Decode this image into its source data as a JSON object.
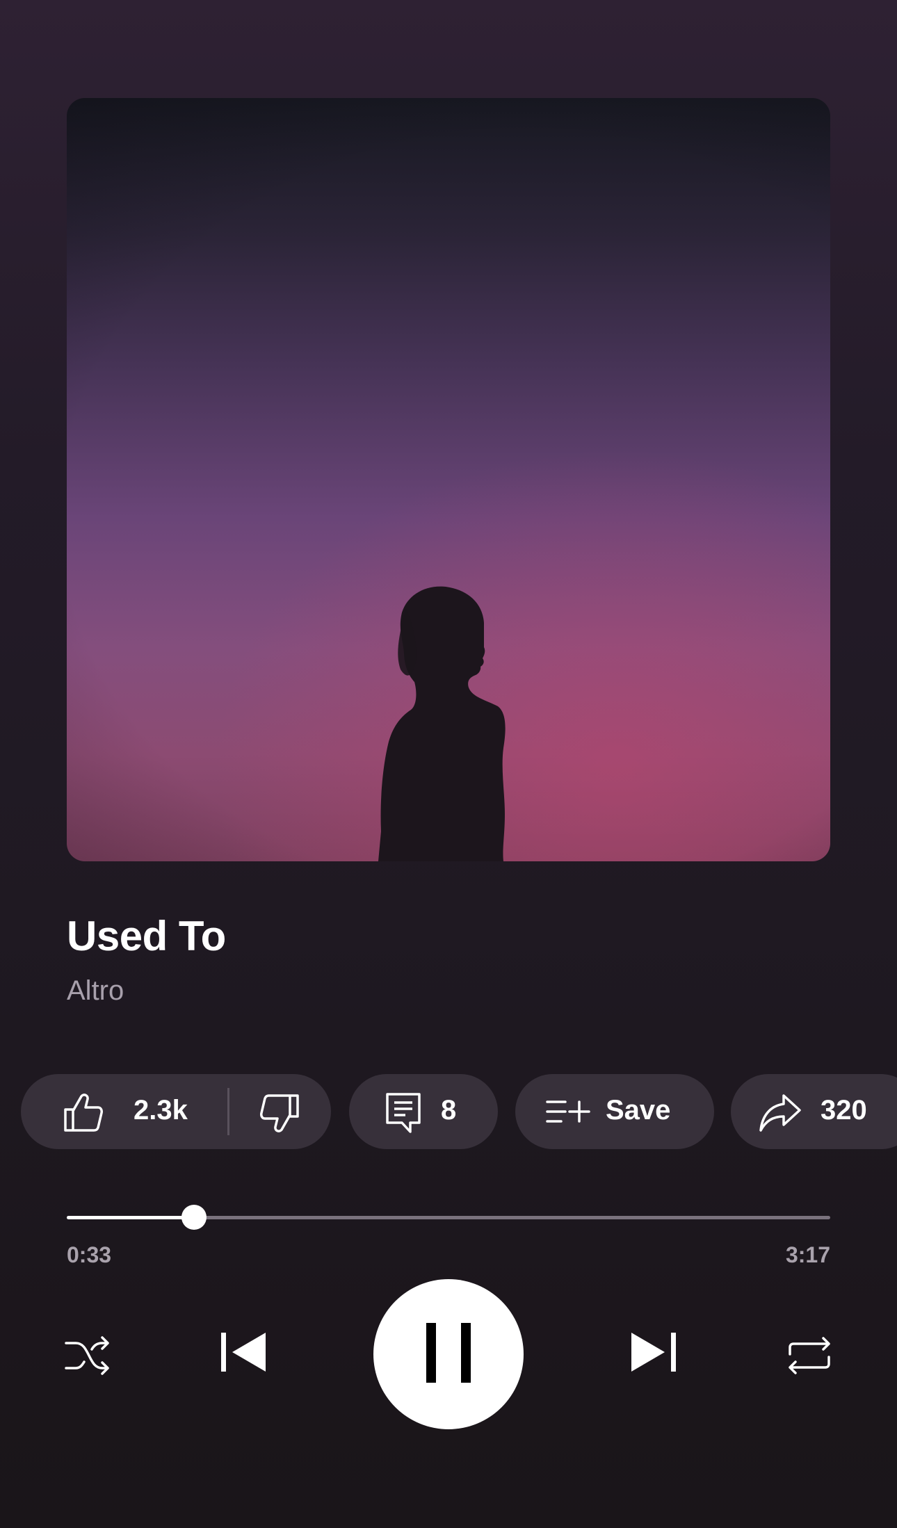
{
  "track": {
    "title": "Used To",
    "artist": "Altro"
  },
  "actions": {
    "likes": "2.3k",
    "comments": "8",
    "save_label": "Save",
    "shares": "320"
  },
  "playback": {
    "elapsed": "0:33",
    "duration": "3:17",
    "progress_fraction": 0.167,
    "state": "playing"
  },
  "icons": {
    "like": "thumbs-up-icon",
    "dislike": "thumbs-down-icon",
    "comment": "comment-icon",
    "save": "playlist-add-icon",
    "share": "share-icon",
    "shuffle": "shuffle-icon",
    "previous": "skip-previous-icon",
    "pause": "pause-icon",
    "next": "skip-next-icon",
    "repeat": "repeat-icon"
  },
  "colors": {
    "background": "#231b28",
    "pill": "#37303a",
    "secondary_text": "#a8a0ac",
    "track": "#7a727d",
    "accent": "#ffffff"
  }
}
